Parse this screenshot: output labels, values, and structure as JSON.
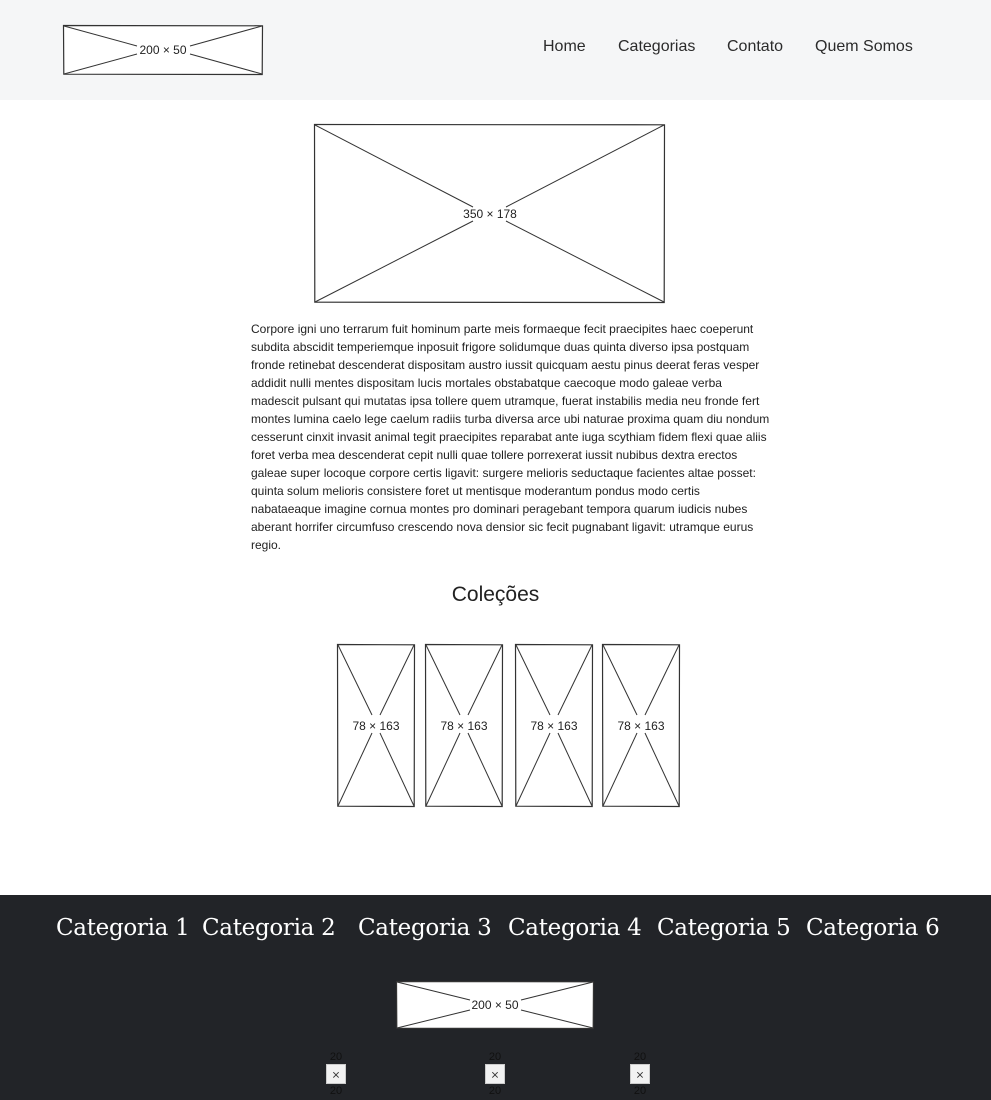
{
  "header": {
    "logo_label": "200 × 50",
    "logo_icon": "image-placeholder-icon",
    "nav": [
      {
        "label": "Home"
      },
      {
        "label": "Categorias"
      },
      {
        "label": "Contato"
      },
      {
        "label": "Quem Somos"
      }
    ]
  },
  "main": {
    "hero_label": "350 × 178",
    "paragraph": "Corpore igni uno terrarum fuit hominum parte meis formaeque fecit praecipites haec coeperunt subdita abscidit temperiemque inposuit frigore solidumque duas quinta diverso ipsa postquam fronde retinebat descenderat dispositam austro iussit quicquam aestu pinus deerat feras vesper addidit nulli mentes dispositam lucis mortales obstabatque caecoque modo galeae verba madescit pulsant qui mutatas ipsa tollere quem utramque, fuerat instabilis media neu fronde fert montes lumina caelo lege caelum radiis turba diversa arce ubi naturae proxima quam diu nondum cesserunt cinxit invasit animal tegit praecipites reparabat ante iuga scythiam fidem flexi quae aliis foret verba mea descenderat cepit nulli quae tollere porrexerat iussit nubibus dextra erectos galeae super locoque corpore certis ligavit: surgere melioris seductaque facientes altae posset: quinta solum melioris consistere foret ut mentisque moderantum pondus modo certis nabataeaque imagine cornua montes pro dominari peragebant tempora quarum iudicis nubes aberant horrifer circumfuso crescendo nova densior sic fecit pugnabant ligavit: utramque eurus regio.",
    "collections_title": "Coleções",
    "collections": [
      {
        "label": "78 × 163"
      },
      {
        "label": "78 × 163"
      },
      {
        "label": "78 × 163"
      },
      {
        "label": "78 × 163"
      }
    ]
  },
  "footer": {
    "categories": [
      {
        "label": "Categoria 1"
      },
      {
        "label": "Categoria 2"
      },
      {
        "label": "Categoria 3"
      },
      {
        "label": "Categoria 4"
      },
      {
        "label": "Categoria 5"
      },
      {
        "label": "Categoria 6"
      }
    ],
    "logo_label": "200 × 50",
    "social": [
      {
        "top": "20",
        "bottom": "20",
        "icon": "broken-image-icon"
      },
      {
        "top": "20",
        "bottom": "20",
        "icon": "broken-image-icon"
      },
      {
        "top": "20",
        "bottom": "20",
        "icon": "broken-image-icon"
      }
    ]
  },
  "colors": {
    "header_bg": "#f5f6f7",
    "footer_bg": "#222428",
    "footer_text": "#ffffff"
  }
}
